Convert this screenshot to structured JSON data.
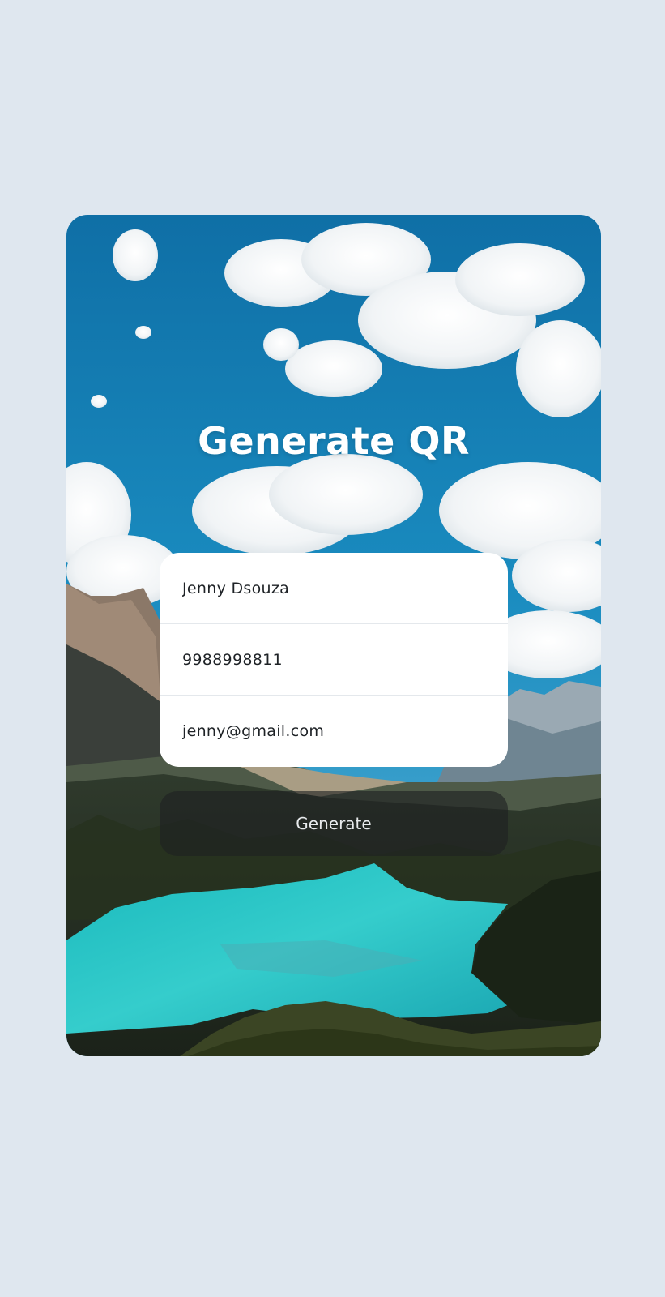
{
  "header": {
    "title": "Generate QR"
  },
  "form": {
    "name_value": "Jenny Dsouza",
    "phone_value": "9988998811",
    "email_value": "jenny@gmail.com"
  },
  "actions": {
    "generate_label": "Generate"
  },
  "colors": {
    "page_background": "#dfe7ef",
    "sky": "#1a86b8",
    "lake": "#2ec7c9",
    "form_background": "#ffffff",
    "button_overlay": "#1e2022"
  }
}
